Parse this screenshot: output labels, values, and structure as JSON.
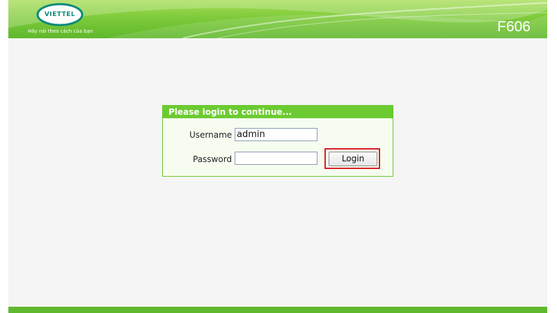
{
  "header": {
    "logo_text": "VIETTEL",
    "slogan": "Hãy nói theo cách của bạn",
    "model": "F606"
  },
  "login": {
    "title": "Please login to continue...",
    "username_label": "Username",
    "username_value": "admin",
    "password_label": "Password",
    "password_value": "",
    "button_label": "Login"
  },
  "colors": {
    "brand_green": "#6ccb31",
    "highlight_red": "#d91e25",
    "logo_teal": "#0a8a7a"
  }
}
